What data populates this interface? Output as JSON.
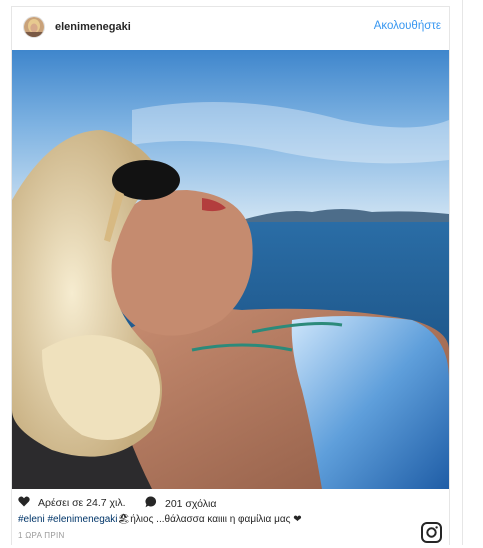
{
  "post": {
    "username": "elenimenegaki",
    "follow_label": "Ακολουθήστε",
    "likes_label": "Αρέσει σε 24.7 χιλ.",
    "comments_label": "201 σχόλια",
    "caption": {
      "hashtag_1": "#eleni",
      "hashtag_2": "#elenimenegaki",
      "text": "🏖ήλιος ...θάλασσα καιιιι η φαμίλια μας ❤"
    },
    "time_label": "1 ΩΡΑ ΠΡΙΝ"
  },
  "icons": {
    "avatar": "avatar",
    "like": "heart-icon",
    "comment": "comment-bubble-icon",
    "brand": "instagram-logo-icon"
  },
  "colors": {
    "accent": "#3897f0",
    "text": "#262626",
    "hashtag": "#003569",
    "muted": "#999999"
  }
}
